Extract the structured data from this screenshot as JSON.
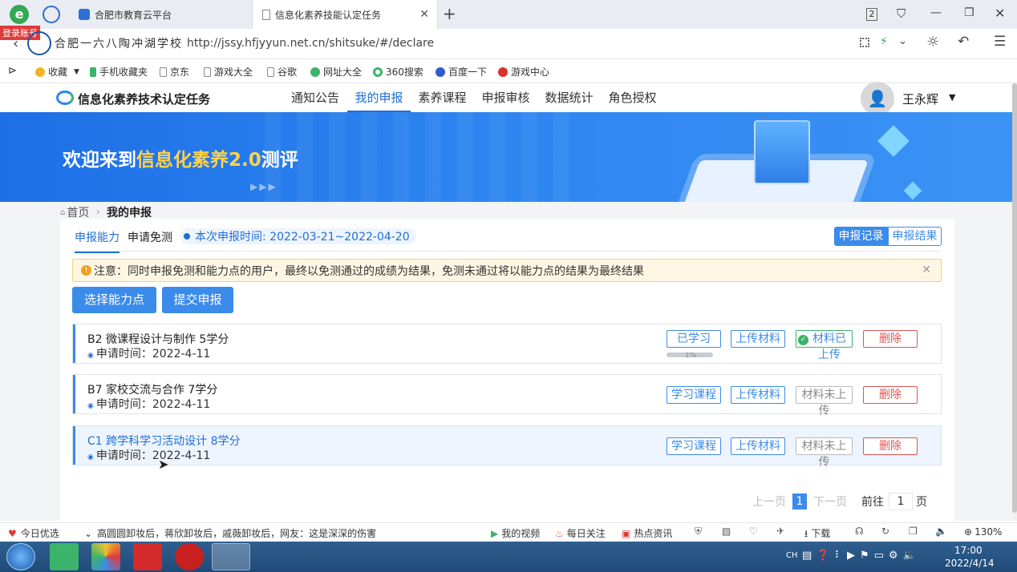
{
  "browser": {
    "tabs": [
      {
        "label": "合肥市教育云平台"
      },
      {
        "label": "信息化素养技能认定任务"
      }
    ],
    "tab_count": "2",
    "login_badge": "登录账号",
    "url": "http://jssy.hfjyyun.net.cn/shitsuke/#/declare",
    "bookmarks": [
      "收藏",
      "手机收藏夹",
      "京东",
      "游戏大全",
      "谷歌",
      "网址大全",
      "360搜索",
      "百度一下",
      "游戏中心"
    ]
  },
  "site": {
    "name": "信息化素养技术认定任务",
    "school_logo_text": "合肥一六八陶冲湖学校",
    "nav": [
      "通知公告",
      "我的申报",
      "素养课程",
      "申报审核",
      "数据统计",
      "角色授权"
    ],
    "active_nav": "我的申报",
    "user": "王永辉"
  },
  "banner": {
    "prefix": "欢迎来到",
    "highlight": "信息化素养2.0",
    "suffix": "测评"
  },
  "breadcrumb": {
    "home": "首页",
    "current": "我的申报"
  },
  "tabs": {
    "ability": "申报能力",
    "exempt": "申请免测"
  },
  "period": "本次申报时间: 2022-03-21~2022-04-20",
  "record_buttons": {
    "records": "申报记录",
    "results": "申报结果"
  },
  "notice": "注意：同时申报免测和能力点的用户，最终以免测通过的成绩为结果，免测未通过将以能力点的结果为最终结果",
  "actions": {
    "select": "选择能力点",
    "submit": "提交申报"
  },
  "items": [
    {
      "title": "B2 微课程设计与制作 5学分",
      "time": "申请时间：2022-4-11",
      "study": "已学习",
      "upload": "上传材料",
      "status": "材料已上传",
      "delete": "删除",
      "progress": 1.0,
      "progress_label": "1%"
    },
    {
      "title": "B7 家校交流与合作 7学分",
      "time": "申请时间：2022-4-11",
      "study": "学习课程",
      "upload": "上传材料",
      "status": "材料未上传",
      "delete": "删除"
    },
    {
      "title": "C1 跨学科学习活动设计 8学分",
      "time": "申请时间：2022-4-11",
      "study": "学习课程",
      "upload": "上传材料",
      "status": "材料未上传",
      "delete": "删除"
    }
  ],
  "pagination": {
    "prev": "上一页",
    "page": "1",
    "next": "下一页",
    "goto_prefix": "前往",
    "goto_value": "1",
    "goto_suffix": "页"
  },
  "statusbar": {
    "left": "今日优选",
    "news": "高圆圆卸妆后，蒋欣卸妆后，戚薇卸妆后，网友：这是深深的伤害",
    "video": "我的视频",
    "daily": "每日关注",
    "hot": "热点资讯",
    "download": "下载",
    "zoom": "130%"
  },
  "taskbar": {
    "lang": "CH",
    "time": "17:00",
    "date": "2022/4/14"
  },
  "colors": {
    "primary": "#3b8bea",
    "danger": "#e05353",
    "banner": "#2d86f0",
    "highlight": "#ffd24a"
  }
}
